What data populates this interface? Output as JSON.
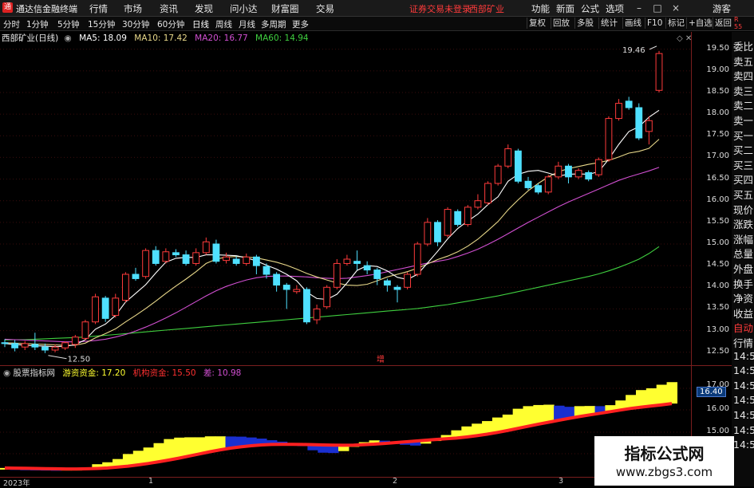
{
  "app": {
    "title": "通达信金融终端"
  },
  "menu": {
    "items": [
      "行情",
      "市场",
      "资讯",
      "发现",
      "问小达",
      "财富圈",
      "交易"
    ]
  },
  "status": {
    "login": "证券交易未登录",
    "stock": "西部矿业"
  },
  "window": {
    "buttons": [
      "功能",
      "新面",
      "公式",
      "选项"
    ],
    "guest": "游客"
  },
  "periods": {
    "items": [
      "分时",
      "1分钟",
      "5分钟",
      "15分钟",
      "30分钟",
      "60分钟",
      "日线",
      "周线",
      "月线",
      "多周期",
      "更多"
    ],
    "active": "日线"
  },
  "toolbar": {
    "items": [
      "复权",
      "回放",
      "多股",
      "统计",
      "画线",
      "F10",
      "标记",
      "+自选",
      "返回"
    ]
  },
  "stock_title": "西部矿业(日线)",
  "ma": {
    "ma5": {
      "label": "MA5: 18.09",
      "color": "#ffffff"
    },
    "ma10": {
      "label": "MA10: 17.42",
      "color": "#e8d88a"
    },
    "ma20": {
      "label": "MA20: 16.77",
      "color": "#d14fd1"
    },
    "ma60": {
      "label": "MA60: 14.94",
      "color": "#3fcf3f"
    }
  },
  "price_axis": [
    "19.50",
    "19.00",
    "18.50",
    "18.00",
    "17.50",
    "17.00",
    "16.50",
    "16.00",
    "15.50",
    "15.00",
    "14.50",
    "14.00",
    "13.50",
    "13.00",
    "12.50"
  ],
  "annotations": {
    "high": "19.46",
    "low": "12.50",
    "zeng": "增"
  },
  "indicator": {
    "name": "股票指标网",
    "l1": {
      "label": "游资资金: 17.20",
      "color": "#ffff30"
    },
    "l2": {
      "label": "机构资金: 15.50",
      "color": "#ff3030"
    },
    "l3": {
      "label": "差: 10.98",
      "color": "#d14fd1"
    }
  },
  "sub_axis": {
    "ticks": [
      "17.00",
      "16.00",
      "15.00"
    ],
    "current": "16.40"
  },
  "time_axis": {
    "labels": [
      "2023年",
      "1",
      "2",
      "3"
    ]
  },
  "right_panel": {
    "top": "R\n55",
    "items": [
      "委比",
      "卖五",
      "卖四",
      "卖三",
      "卖二",
      "卖一",
      "买一",
      "买二",
      "买三",
      "买四",
      "买五",
      "现价",
      "涨跌",
      "涨幅",
      "总量",
      "外盘",
      "换手",
      "净资",
      "收益",
      "自动",
      "行情",
      "14:5",
      "14:5",
      "14:5",
      "14:5",
      "14:5",
      "14:5",
      "14:5"
    ]
  },
  "watermark": {
    "line1": "指标公式网",
    "line2": "www.zbgs3.com"
  },
  "chart_data": {
    "type": "candlestick",
    "ylim": [
      12.2,
      19.9
    ],
    "candles": [
      [
        12.72,
        12.7,
        12.8,
        12.62
      ],
      [
        12.7,
        12.6,
        12.78,
        12.52
      ],
      [
        12.62,
        12.7,
        12.76,
        12.55
      ],
      [
        12.68,
        12.62,
        12.95,
        12.55
      ],
      [
        12.62,
        12.55,
        12.7,
        12.48
      ],
      [
        12.55,
        12.62,
        12.68,
        12.5
      ],
      [
        12.6,
        12.72,
        12.75,
        12.55
      ],
      [
        12.68,
        12.85,
        12.9,
        12.6
      ],
      [
        12.82,
        13.2,
        13.25,
        12.78
      ],
      [
        13.2,
        13.78,
        13.85,
        13.15
      ],
      [
        13.75,
        13.28,
        13.8,
        13.2
      ],
      [
        13.35,
        13.75,
        13.85,
        13.3
      ],
      [
        13.7,
        14.3,
        14.35,
        13.65
      ],
      [
        14.3,
        14.2,
        14.45,
        14.15
      ],
      [
        14.25,
        14.85,
        14.9,
        14.2
      ],
      [
        14.85,
        14.55,
        14.95,
        14.5
      ],
      [
        14.6,
        14.82,
        14.9,
        14.55
      ],
      [
        14.8,
        14.75,
        14.88,
        14.7
      ],
      [
        14.75,
        14.55,
        14.85,
        14.5
      ],
      [
        14.55,
        14.8,
        14.9,
        14.5
      ],
      [
        14.8,
        15.05,
        15.15,
        14.75
      ],
      [
        15.0,
        14.6,
        15.1,
        14.55
      ],
      [
        14.62,
        14.7,
        14.8,
        14.55
      ],
      [
        14.65,
        14.55,
        14.72,
        14.5
      ],
      [
        14.55,
        14.7,
        14.78,
        14.5
      ],
      [
        14.7,
        14.5,
        14.75,
        14.3
      ],
      [
        14.48,
        14.3,
        14.55,
        14.2
      ],
      [
        14.3,
        14.05,
        14.35,
        13.9
      ],
      [
        14.05,
        13.95,
        14.1,
        13.5
      ],
      [
        13.9,
        13.95,
        14.05,
        13.85
      ],
      [
        13.95,
        13.2,
        14.0,
        13.15
      ],
      [
        13.25,
        13.5,
        13.6,
        13.15
      ],
      [
        13.55,
        14.0,
        14.05,
        13.5
      ],
      [
        14.0,
        14.55,
        14.65,
        13.95
      ],
      [
        14.55,
        14.65,
        14.75,
        14.5
      ],
      [
        14.6,
        14.55,
        14.85,
        14.4
      ],
      [
        14.5,
        14.4,
        14.6,
        14.3
      ],
      [
        14.4,
        14.2,
        14.45,
        14.05
      ],
      [
        14.15,
        14.05,
        14.2,
        13.9
      ],
      [
        14.0,
        13.95,
        14.05,
        13.65
      ],
      [
        14.0,
        14.3,
        14.35,
        13.95
      ],
      [
        14.3,
        15.0,
        15.05,
        14.25
      ],
      [
        15.0,
        15.5,
        15.6,
        14.95
      ],
      [
        15.5,
        15.05,
        15.55,
        14.95
      ],
      [
        15.2,
        15.8,
        15.85,
        15.15
      ],
      [
        15.75,
        15.45,
        15.8,
        15.4
      ],
      [
        15.45,
        15.85,
        15.9,
        15.4
      ],
      [
        15.85,
        16.0,
        16.15,
        15.8
      ],
      [
        15.95,
        16.4,
        16.45,
        15.9
      ],
      [
        16.4,
        16.8,
        16.85,
        16.35
      ],
      [
        16.8,
        17.2,
        17.3,
        16.75
      ],
      [
        17.15,
        16.45,
        17.2,
        16.4
      ],
      [
        16.45,
        16.3,
        16.55,
        16.25
      ],
      [
        16.35,
        16.2,
        16.4,
        16.15
      ],
      [
        16.2,
        16.55,
        16.6,
        16.15
      ],
      [
        16.55,
        16.8,
        16.9,
        16.5
      ],
      [
        16.8,
        16.55,
        16.85,
        16.4
      ],
      [
        16.55,
        16.7,
        16.75,
        16.5
      ],
      [
        16.65,
        16.5,
        16.7,
        16.45
      ],
      [
        16.6,
        16.95,
        17.0,
        16.55
      ],
      [
        16.95,
        17.9,
        17.95,
        16.9
      ],
      [
        17.9,
        18.25,
        18.35,
        17.85
      ],
      [
        18.3,
        18.15,
        18.4,
        18.1
      ],
      [
        18.15,
        17.45,
        18.25,
        17.4
      ],
      [
        17.6,
        17.85,
        17.95,
        17.3
      ],
      [
        18.55,
        19.4,
        19.46,
        18.5
      ]
    ],
    "ma5": [
      12.7,
      12.68,
      12.66,
      12.65,
      12.64,
      12.63,
      12.64,
      12.67,
      12.79,
      13.03,
      13.15,
      13.35,
      13.66,
      13.86,
      14.06,
      14.33,
      14.58,
      14.67,
      14.69,
      14.69,
      14.75,
      14.75,
      14.74,
      14.73,
      14.68,
      14.61,
      14.51,
      14.42,
      14.3,
      14.15,
      13.89,
      13.74,
      13.72,
      13.84,
      14.1,
      14.39,
      14.5,
      14.48,
      14.38,
      14.23,
      14.18,
      14.3,
      14.56,
      14.83,
      15.12,
      15.36,
      15.53,
      15.69,
      15.91,
      16.09,
      16.45,
      16.61,
      16.68,
      16.7,
      16.64,
      16.57,
      16.61,
      16.62,
      16.61,
      16.67,
      16.96,
      17.3,
      17.6,
      17.71,
      17.93,
      18.09
    ],
    "ma10": [
      12.72,
      12.71,
      12.7,
      12.69,
      12.68,
      12.67,
      12.66,
      12.66,
      12.71,
      12.83,
      12.93,
      13.04,
      13.2,
      13.35,
      13.51,
      13.68,
      13.86,
      14.03,
      14.19,
      14.36,
      14.55,
      14.65,
      14.7,
      14.71,
      14.7,
      14.68,
      14.63,
      14.58,
      14.51,
      14.42,
      14.32,
      14.24,
      14.17,
      14.1,
      14.05,
      14.04,
      14.07,
      14.15,
      14.24,
      14.3,
      14.36,
      14.44,
      14.54,
      14.64,
      14.72,
      14.82,
      14.95,
      15.11,
      15.31,
      15.52,
      15.79,
      16.02,
      16.23,
      16.4,
      16.55,
      16.67,
      16.74,
      16.79,
      16.84,
      16.88,
      16.93,
      17.01,
      17.1,
      17.14,
      17.21,
      17.42
    ],
    "ma20": [
      12.8,
      12.79,
      12.78,
      12.77,
      12.76,
      12.75,
      12.74,
      12.74,
      12.75,
      12.77,
      12.8,
      12.85,
      12.91,
      12.99,
      13.08,
      13.18,
      13.29,
      13.41,
      13.54,
      13.67,
      13.8,
      13.92,
      14.02,
      14.1,
      14.17,
      14.22,
      14.25,
      14.26,
      14.26,
      14.25,
      14.24,
      14.22,
      14.21,
      14.2,
      14.21,
      14.24,
      14.27,
      14.31,
      14.36,
      14.41,
      14.46,
      14.51,
      14.56,
      14.6,
      14.64,
      14.71,
      14.79,
      14.88,
      14.99,
      15.11,
      15.24,
      15.37,
      15.5,
      15.62,
      15.74,
      15.86,
      15.97,
      16.07,
      16.17,
      16.27,
      16.37,
      16.47,
      16.55,
      16.62,
      16.69,
      16.77
    ],
    "ma60": [
      12.78,
      12.79,
      12.79,
      12.8,
      12.81,
      12.82,
      12.83,
      12.84,
      12.85,
      12.87,
      12.89,
      12.91,
      12.93,
      12.95,
      12.97,
      12.99,
      13.01,
      13.03,
      13.05,
      13.07,
      13.09,
      13.11,
      13.13,
      13.15,
      13.17,
      13.19,
      13.21,
      13.23,
      13.25,
      13.27,
      13.29,
      13.31,
      13.33,
      13.35,
      13.37,
      13.39,
      13.41,
      13.43,
      13.45,
      13.47,
      13.49,
      13.51,
      13.54,
      13.57,
      13.6,
      13.64,
      13.68,
      13.72,
      13.76,
      13.8,
      13.85,
      13.9,
      13.95,
      14.0,
      14.05,
      14.1,
      14.15,
      14.2,
      14.25,
      14.31,
      14.38,
      14.46,
      14.55,
      14.65,
      14.78,
      14.94
    ]
  }
}
